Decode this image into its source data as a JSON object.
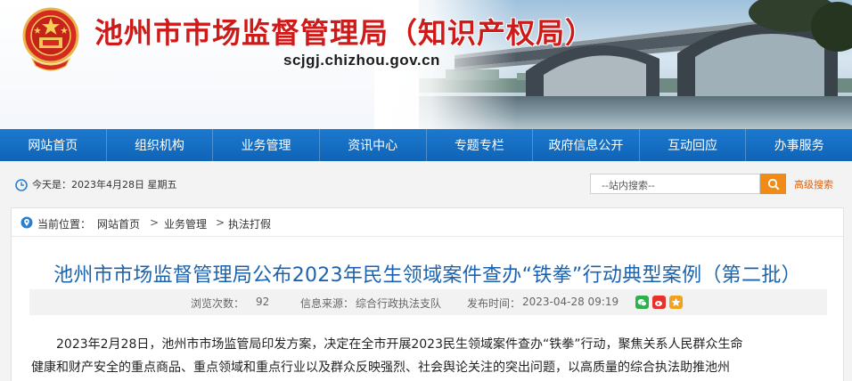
{
  "header": {
    "title": "池州市市场监督管理局（知识产权局）",
    "url": "scjgj.chizhou.gov.cn"
  },
  "nav": {
    "items": [
      "网站首页",
      "组织机构",
      "业务管理",
      "资讯中心",
      "专题专栏",
      "政府信息公开",
      "互动回应",
      "办事服务"
    ]
  },
  "info": {
    "date": "今天是：2023年4月28日 星期五",
    "search_placeholder": "--站内搜索--",
    "advanced_search": "高级搜索"
  },
  "breadcrumb": {
    "label": "当前位置：",
    "items": [
      "网站首页",
      "业务管理",
      "执法打假"
    ],
    "separator": ">"
  },
  "article": {
    "title": "池州市市场监督管理局公布2023年民生领域案件查办“铁拳”行动典型案例（第二批）",
    "views_label": "浏览次数：",
    "views": "92",
    "source_label": "信息来源：",
    "source": "综合行政执法支队",
    "published_label": "发布时间：",
    "published": "2023-04-28 09:19",
    "body": [
      "2023年2月28日，池州市市场监管局印发方案，决定在全市开展2023民生领域案件查办“铁拳”行动，聚焦关系人民群众生命",
      "健康和财产安全的重点商品、重点领域和重点行业以及群众反映强烈、社会舆论关注的突出问题，以高质量的综合执法助推池州"
    ]
  },
  "colors": {
    "nav": "#1469bf",
    "title_red": "#cf1a1a",
    "article_title": "#1b63ae",
    "search_button": "#f08b18"
  }
}
